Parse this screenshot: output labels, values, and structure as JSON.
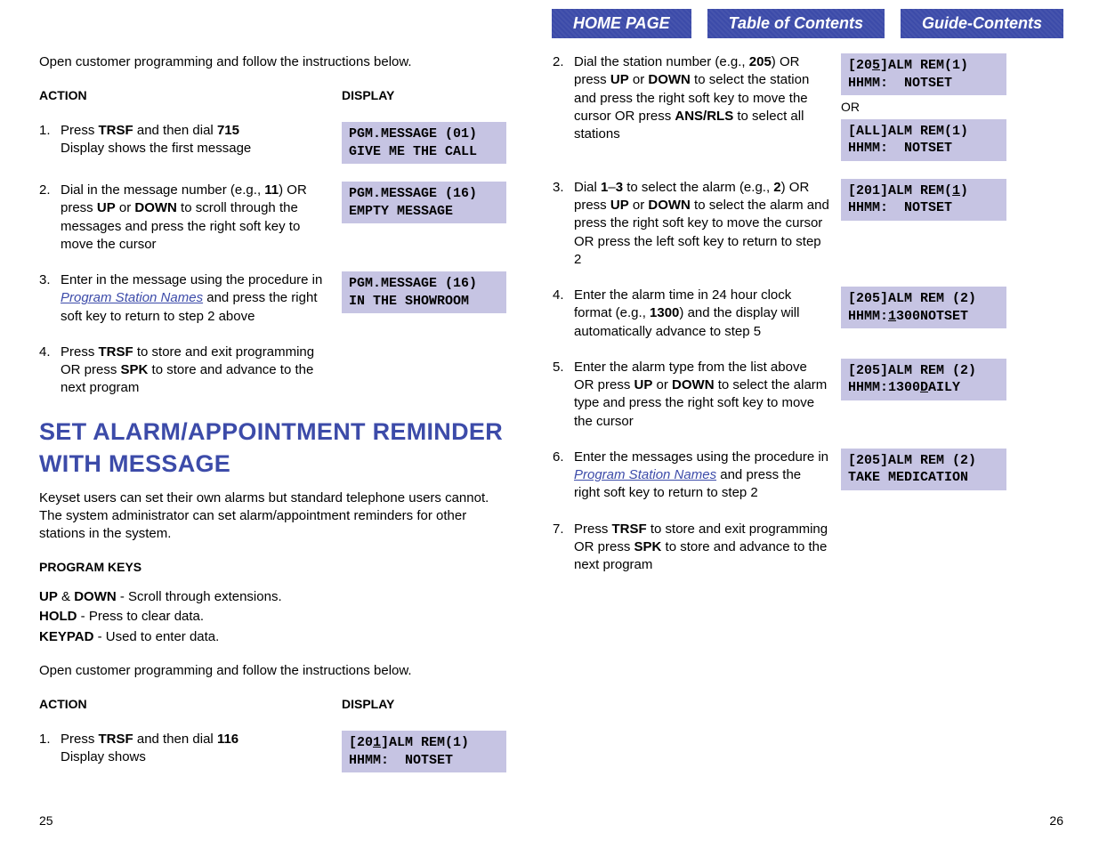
{
  "nav": {
    "home": "HOME PAGE",
    "toc": "Table of Contents",
    "guide": "Guide-Contents"
  },
  "left": {
    "intro": "Open customer programming and follow the instructions below.",
    "headers": {
      "action": "ACTION",
      "display": "DISPLAY"
    },
    "items": [
      {
        "num": "1.",
        "text_parts": [
          "Press ",
          "TRSF",
          " and then dial ",
          "715"
        ],
        "text_line2": "Display shows the first message",
        "display": "PGM.MESSAGE (01)\nGIVE ME THE CALL"
      },
      {
        "num": "2.",
        "text_parts": [
          "Dial in the message number (e.g., ",
          "11",
          ") OR press ",
          "UP",
          " or ",
          "DOWN",
          " to scroll through the messages and press the right soft key to move the cursor"
        ],
        "display": "PGM.MESSAGE (16)\nEMPTY MESSAGE"
      },
      {
        "num": "3.",
        "text_pre": "Enter in the message using the procedure in ",
        "link": "Program Station Names",
        "text_post": " and press the right soft key to return to step 2 above",
        "display": "PGM.MESSAGE (16)\nIN THE SHOWROOM"
      },
      {
        "num": "4.",
        "text_parts": [
          "Press ",
          "TRSF",
          " to store and exit programming OR press ",
          "SPK",
          " to store and advance to the next program"
        ]
      }
    ],
    "heading": "SET ALARM/APPOINTMENT REMINDER WITH MESSAGE",
    "body_p": "Keyset users can set their own alarms but standard telephone users cannot. The system administrator can set alarm/appointment reminders for other stations in the system.",
    "prog_keys_header": "PROGRAM KEYS",
    "prog_keys": [
      {
        "key": "UP",
        "sep": " & ",
        "key2": "DOWN",
        "desc": " - Scroll through extensions."
      },
      {
        "key": "HOLD",
        "desc": " - Press to clear data."
      },
      {
        "key": "KEYPAD",
        "desc": " - Used to enter data."
      }
    ],
    "intro2": "Open customer programming and follow the instructions below.",
    "items2": [
      {
        "num": "1.",
        "text_parts": [
          "Press ",
          "TRSF",
          " and then dial ",
          "116"
        ],
        "text_line2": "Display shows",
        "display_parts": [
          "[20",
          "1",
          "]ALM REM(1)\nHHMM:  NOTSET"
        ]
      }
    ]
  },
  "right": {
    "items": [
      {
        "num": "2.",
        "text_parts": [
          "Dial the station number (e.g., ",
          "205",
          ") OR press ",
          "UP",
          " or ",
          "DOWN",
          " to select the station and press the right soft key to move the cursor OR press ",
          "ANS/RLS",
          " to select all stations"
        ],
        "display_parts": [
          "[20",
          "5",
          "]ALM REM(1)\nHHMM:  NOTSET"
        ],
        "or": "OR",
        "display2": "[ALL]ALM REM(1)\nHHMM:  NOTSET"
      },
      {
        "num": "3.",
        "text_parts": [
          "Dial ",
          "1",
          "–",
          "3",
          " to select the alarm (e.g., ",
          "2",
          ") OR press ",
          "UP",
          " or ",
          "DOWN",
          " to select the alarm and press the right soft key to move the cursor OR press the left soft key to return to step 2"
        ],
        "display_parts": [
          "[201]ALM REM(",
          "1",
          ")\nHHMM:  NOTSET"
        ]
      },
      {
        "num": "4.",
        "text_parts": [
          "Enter the alarm time in 24 hour clock format (e.g., ",
          "1300",
          ") and the display will automatically advance to step 5"
        ],
        "display_parts": [
          "[205]ALM REM (2)\nHHMM:",
          "1",
          "300NOTSET"
        ]
      },
      {
        "num": "5.",
        "text_parts": [
          "Enter the alarm type from the list above OR press ",
          "UP",
          " or ",
          "DOWN",
          " to select the alarm type and press the right soft key to move the cursor"
        ],
        "display_parts": [
          "[205]ALM REM (2)\nHHMM:1300",
          "D",
          "AILY"
        ]
      },
      {
        "num": "6.",
        "text_pre": "Enter the messages using the procedure in ",
        "link": "Program Station Names",
        "text_post": " and press the right soft key to return to step 2",
        "display": "[205]ALM REM (2)\nTAKE MEDICATION"
      },
      {
        "num": "7.",
        "text_parts": [
          "Press ",
          "TRSF",
          " to store and exit programming OR press ",
          "SPK",
          " to store and advance to the next program"
        ]
      }
    ]
  },
  "page_left": "25",
  "page_right": "26"
}
